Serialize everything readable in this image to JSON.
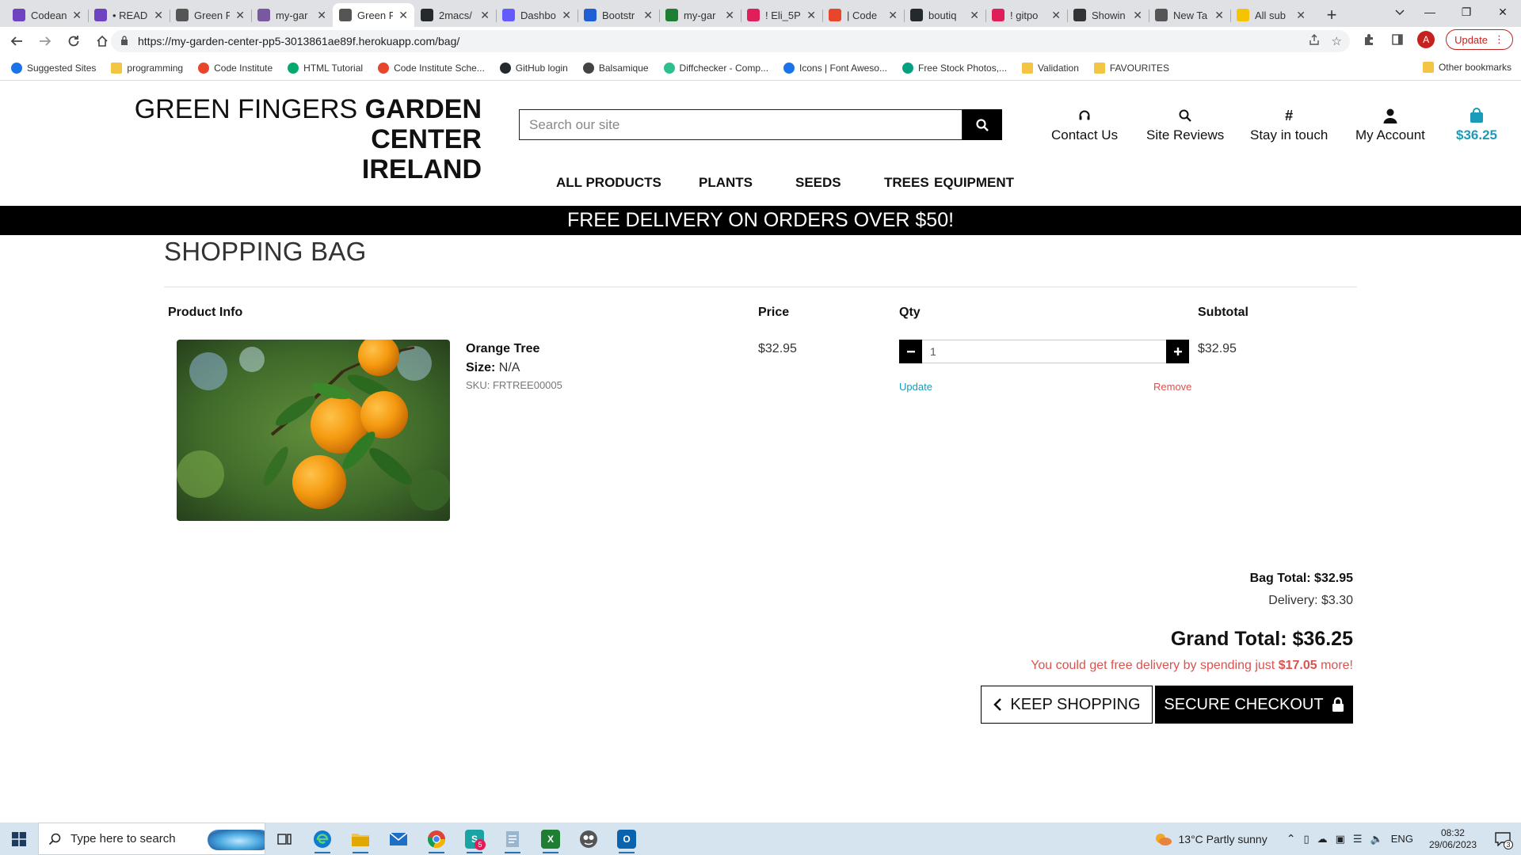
{
  "browser": {
    "tabs": [
      {
        "title": "Codean",
        "icon": "codeanywhere-icon",
        "color": "#6f42c1"
      },
      {
        "title": "• READ",
        "icon": "codeanywhere-icon",
        "color": "#6f42c1"
      },
      {
        "title": "Green F",
        "icon": "globe-icon",
        "color": "#555555"
      },
      {
        "title": "my-gar",
        "icon": "heroku-icon",
        "color": "#79589f"
      },
      {
        "title": "Green F",
        "icon": "globe-icon",
        "color": "#555555",
        "active": true
      },
      {
        "title": "2macs/",
        "icon": "github-icon",
        "color": "#24292e"
      },
      {
        "title": "Dashbo",
        "icon": "stripe-icon",
        "color": "#635bff"
      },
      {
        "title": "Bootstr",
        "icon": "bootstrap-icon",
        "color": "#1f5fd6"
      },
      {
        "title": "my-gar",
        "icon": "sheet-icon",
        "color": "#1e7e34"
      },
      {
        "title": "! Eli_5P",
        "icon": "slack-icon",
        "color": "#e01e5a"
      },
      {
        "title": "| Code",
        "icon": "code-institute-icon",
        "color": "#e8462b"
      },
      {
        "title": "boutiq",
        "icon": "github-icon",
        "color": "#24292e"
      },
      {
        "title": "! gitpo",
        "icon": "slack-icon",
        "color": "#e01e5a"
      },
      {
        "title": "Showin",
        "icon": "markdown-icon",
        "color": "#333333"
      },
      {
        "title": "New Ta",
        "icon": "chrome-icon",
        "color": "#555555"
      },
      {
        "title": "All sub",
        "icon": "norton-icon",
        "color": "#f5c400"
      }
    ],
    "url": "https://my-garden-center-pp5-3013861ae89f.herokuapp.com/bag/",
    "update_label": "Update",
    "profile_initial": "A",
    "bookmarks": [
      {
        "label": "Suggested Sites",
        "icon": "search-icon",
        "color": "#1a73e8"
      },
      {
        "label": "programming",
        "icon": "folder-icon",
        "color": "#f4c542"
      },
      {
        "label": "Code Institute",
        "icon": "code-institute-icon",
        "color": "#e8462b"
      },
      {
        "label": "HTML Tutorial",
        "icon": "w3schools-icon",
        "color": "#04aa6d"
      },
      {
        "label": "Code Institute Sche...",
        "icon": "code-institute-icon",
        "color": "#e8462b"
      },
      {
        "label": "GitHub login",
        "icon": "github-icon",
        "color": "#24292e"
      },
      {
        "label": "Balsamique",
        "icon": "balsamiq-icon",
        "color": "#444444"
      },
      {
        "label": "Diffchecker - Comp...",
        "icon": "diffchecker-icon",
        "color": "#2dbf8f"
      },
      {
        "label": "Icons | Font Aweso...",
        "icon": "flag-icon",
        "color": "#1a73e8"
      },
      {
        "label": "Free Stock Photos,...",
        "icon": "pexels-icon",
        "color": "#05a081"
      },
      {
        "label": "Validation",
        "icon": "folder-icon",
        "color": "#f4c542"
      },
      {
        "label": "FAVOURITES",
        "icon": "folder-icon",
        "color": "#f4c542"
      }
    ],
    "other_bookmarks": "Other bookmarks"
  },
  "site": {
    "brand_light": "GREEN FINGERS",
    "brand_bold_1": "GARDEN CENTER",
    "brand_bold_2": "IRELAND",
    "search_placeholder": "Search our site",
    "header_links": {
      "contact": "Contact Us",
      "reviews": "Site Reviews",
      "stay": "Stay in touch",
      "account": "My Account",
      "bag_total": "$36.25"
    },
    "nav": [
      "ALL PRODUCTS",
      "PLANTS",
      "SEEDS",
      "TREES",
      "EQUIPMENT"
    ],
    "banner": "FREE DELIVERY ON ORDERS OVER $50!",
    "accent_color": "#1a9bb8",
    "danger_color": "#d9534f"
  },
  "bag": {
    "title": "SHOPPING BAG",
    "headers": {
      "product": "Product Info",
      "price": "Price",
      "qty": "Qty",
      "subtotal": "Subtotal"
    },
    "items": [
      {
        "name": "Orange Tree",
        "size_label": "Size:",
        "size": "N/A",
        "sku": "SKU: FRTREE00005",
        "price": "$32.95",
        "qty": "1",
        "subtotal": "$32.95",
        "update_label": "Update",
        "remove_label": "Remove"
      }
    ],
    "bag_total_label": "Bag Total: $32.95",
    "delivery_label": "Delivery: $3.30",
    "grand_total_label": "Grand Total: $36.25",
    "free_delivery_prefix": "You could get free delivery by spending just",
    "free_delivery_amount": "$17.05",
    "free_delivery_suffix": "more!",
    "keep_shopping": "KEEP SHOPPING",
    "checkout": "SECURE CHECKOUT"
  },
  "taskbar": {
    "search_placeholder": "Type here to search",
    "mail_badge": "5",
    "weather": "13°C  Partly sunny",
    "language": "ENG",
    "time": "08:32",
    "date": "29/06/2023",
    "notification_count": "3"
  }
}
